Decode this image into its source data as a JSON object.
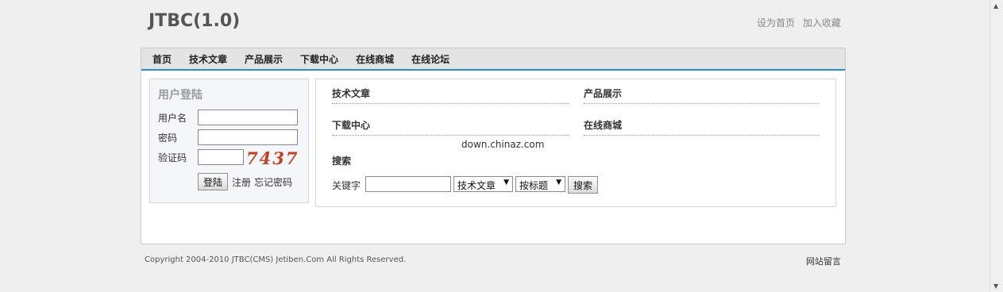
{
  "header": {
    "title": "JTBC(1.0)",
    "links": [
      "设为首页",
      "加入收藏"
    ]
  },
  "nav": {
    "items": [
      "首页",
      "技术文章",
      "产品展示",
      "下载中心",
      "在线商城",
      "在线论坛"
    ],
    "accent_color": "#2a8fc6"
  },
  "login": {
    "title": "用户登陆",
    "username_label": "用户名",
    "password_label": "密码",
    "captcha_label": "验证码",
    "captcha_text": "7437",
    "username_value": "",
    "password_value": "",
    "captcha_value": "",
    "login_button": "登陆",
    "register_link": "注册",
    "forgot_link": "忘记密码"
  },
  "content": {
    "categories": [
      "技术文章",
      "产品展示",
      "下载中心",
      "在线商城"
    ],
    "watermark": "down.chinaz.com",
    "search": {
      "title": "搜索",
      "keyword_label": "关键字",
      "keyword_value": "",
      "category_select": "技术文章",
      "mode_select": "按标题",
      "button": "搜索"
    }
  },
  "footer": {
    "copyright": "Copyright 2004-2010 JTBC(CMS) Jetiben.Com All Rights Reserved.",
    "guestbook": "网站留言"
  },
  "icons": {
    "dropdown": "chevron-down-icon",
    "scroll_up": "arrow-up-icon",
    "scroll_down": "arrow-down-icon"
  }
}
